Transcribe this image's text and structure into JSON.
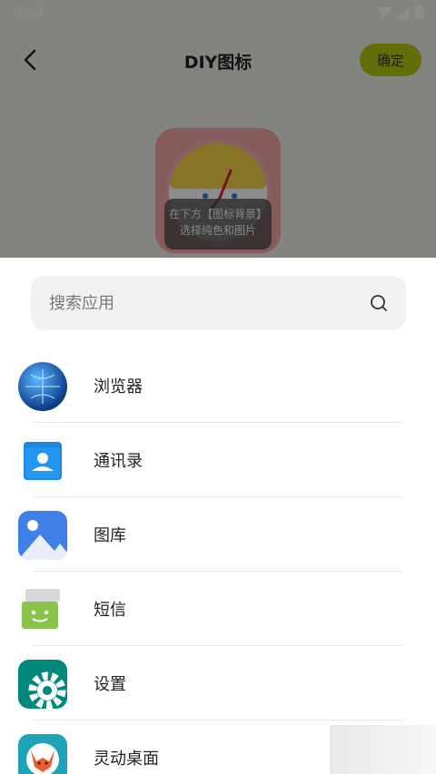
{
  "status_bar": {
    "time": "9:38"
  },
  "header": {
    "title": "DIY图标",
    "confirm_label": "确定"
  },
  "preview": {
    "hint_line1": "在下方【图标背景】",
    "hint_line2": "选择纯色和图片"
  },
  "search": {
    "placeholder": "搜索应用"
  },
  "apps": [
    {
      "label": "浏览器",
      "icon": "globe-icon"
    },
    {
      "label": "通讯录",
      "icon": "contacts-icon"
    },
    {
      "label": "图库",
      "icon": "gallery-icon"
    },
    {
      "label": "短信",
      "icon": "messages-icon"
    },
    {
      "label": "设置",
      "icon": "settings-icon"
    },
    {
      "label": "灵动桌面",
      "icon": "fox-icon"
    }
  ],
  "colors": {
    "accent": "#b7c80f",
    "overlay": "rgba(0,0,0,0.45)"
  }
}
